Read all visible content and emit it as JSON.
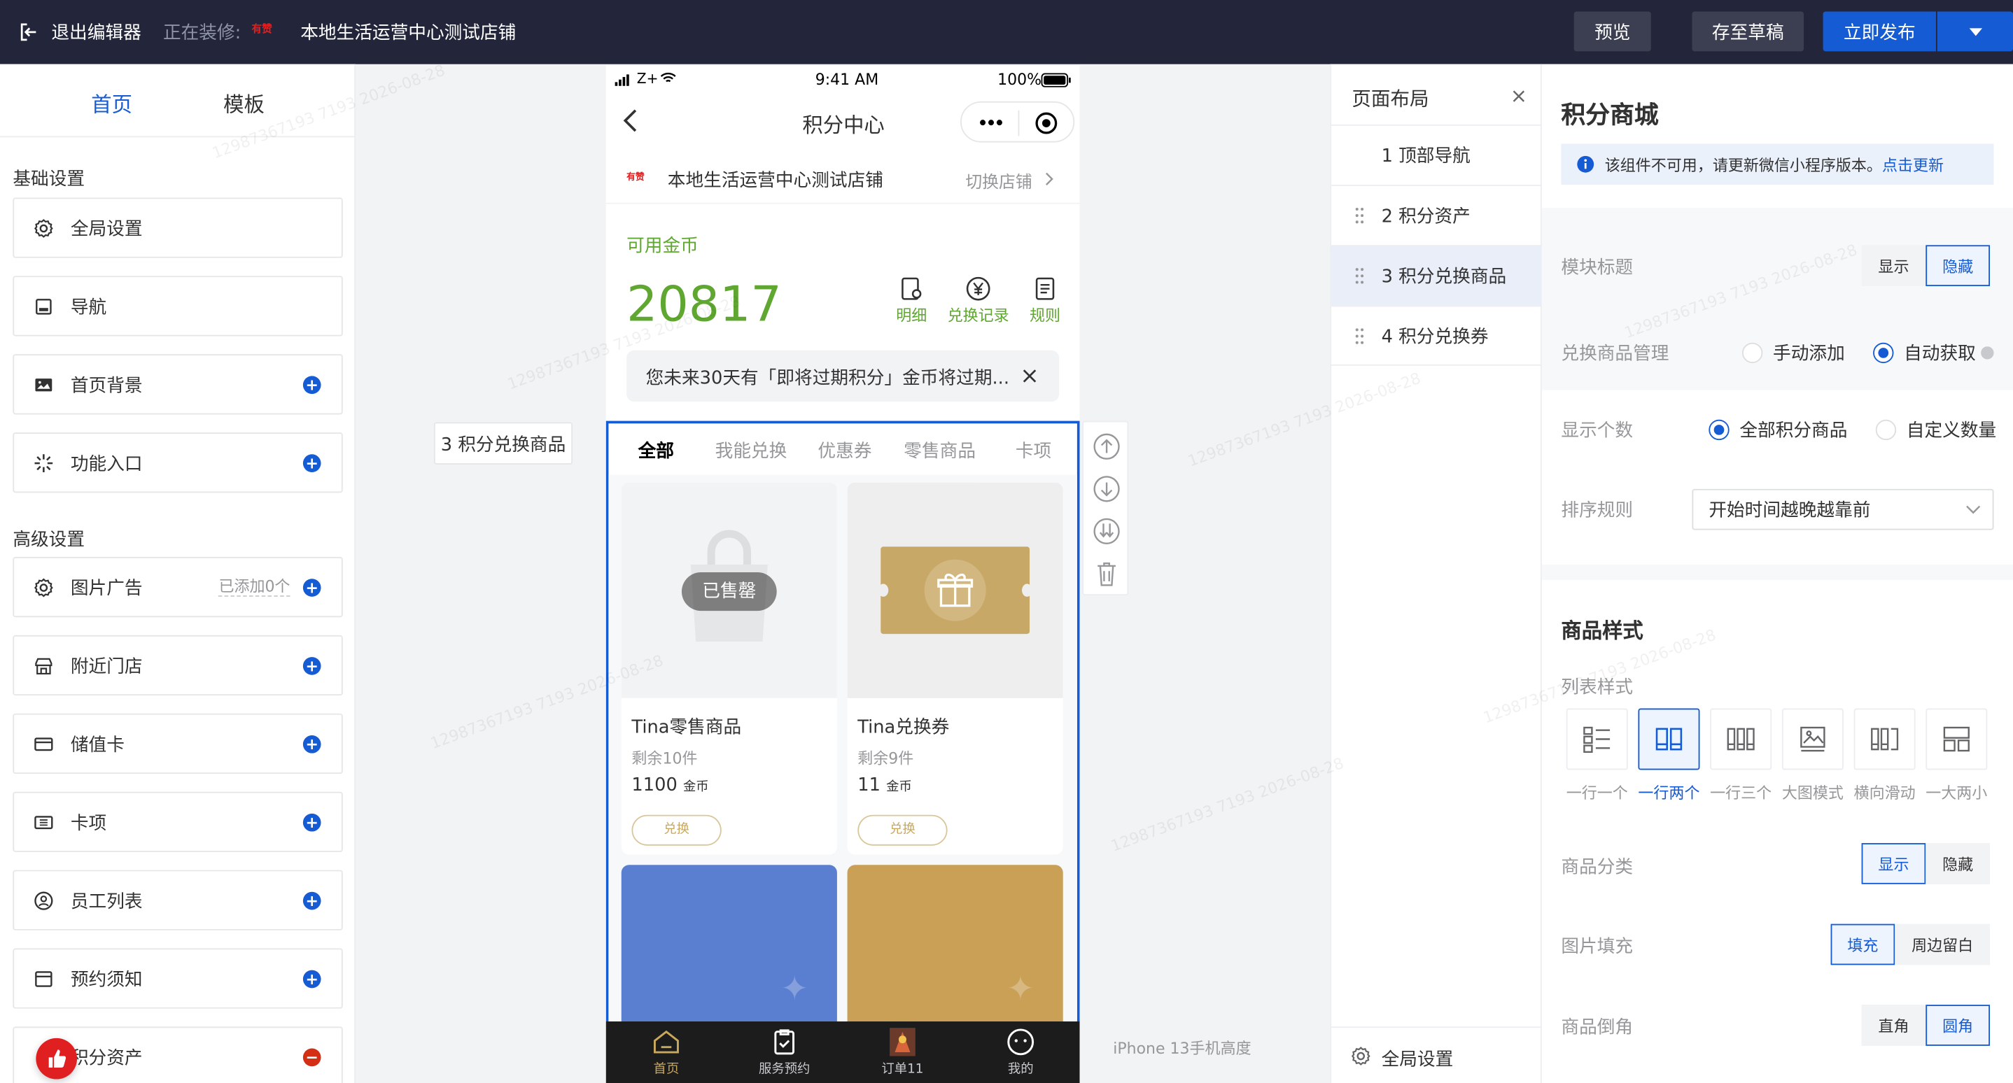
{
  "topbar": {
    "exit_label": "退出编辑器",
    "editing_label": "正在装修:",
    "shop_logo_text": "有赞",
    "shop_name": "本地生活运营中心测试店铺",
    "preview": "预览",
    "save_draft": "存至草稿",
    "publish": "立即发布"
  },
  "left": {
    "tabs": [
      "首页",
      "模板"
    ],
    "basic_title": "基础设置",
    "advanced_title": "高级设置",
    "items": [
      {
        "label": "全局设置",
        "icon": "gear-icon"
      },
      {
        "label": "导航",
        "icon": "nav-icon"
      },
      {
        "label": "首页背景",
        "icon": "image-icon"
      },
      {
        "label": "功能入口",
        "icon": "spark-icon"
      },
      {
        "label": "图片广告",
        "icon": "gear-icon",
        "note": "已添加0个"
      },
      {
        "label": "附近门店",
        "icon": "store-icon"
      },
      {
        "label": "储值卡",
        "icon": "card-icon"
      },
      {
        "label": "卡项",
        "icon": "ticket-icon"
      },
      {
        "label": "员工列表",
        "icon": "user-icon"
      },
      {
        "label": "预约须知",
        "icon": "notice-icon"
      },
      {
        "label": "积分资产",
        "icon": "bulb-icon"
      }
    ]
  },
  "canvas": {
    "component_label": "3 积分兑换商品",
    "iphone_height": "iPhone 13手机高度"
  },
  "phone": {
    "status": {
      "carrier": "Z+",
      "time": "9:41 AM",
      "battery": "100%"
    },
    "title": "积分中心",
    "shop_name": "本地生活运营中心测试店铺",
    "switch_shop": "切换店铺",
    "coin_label": "可用金币",
    "coin_value": "20817",
    "quick": [
      "明细",
      "兑换记录",
      "规则"
    ],
    "notice": "您未来30天有「即将过期积分」金币将过期...",
    "tabs": [
      "全部",
      "我能兑换",
      "优惠券",
      "零售商品",
      "卡项"
    ],
    "products": [
      {
        "name": "Tina零售商品",
        "stock": "剩余10件",
        "price": "1100",
        "unit": "金币",
        "btn": "兑换",
        "sold_out": "已售罄"
      },
      {
        "name": "Tina兑换券",
        "stock": "剩余9件",
        "price": "11",
        "unit": "金币",
        "btn": "兑换"
      }
    ],
    "bottom_nav": [
      "首页",
      "服务预约",
      "订单11",
      "我的"
    ]
  },
  "layout": {
    "title": "页面布局",
    "items": [
      "1 顶部导航",
      "2 积分资产",
      "3 积分兑换商品",
      "4 积分兑换券"
    ],
    "global": "全局设置"
  },
  "right": {
    "title": "积分商城",
    "alert": "该组件不可用，请更新微信小程序版本。",
    "alert_link": "点击更新",
    "module_title": "模块标题",
    "show": "显示",
    "hide": "隐藏",
    "manage": "兑换商品管理",
    "manual": "手动添加",
    "auto": "自动获取",
    "count": "显示个数",
    "all_goods": "全部积分商品",
    "custom_count": "自定义数量",
    "sort": "排序规则",
    "sort_value": "开始时间越晚越靠前",
    "style_title": "商品样式",
    "list_style": "列表样式",
    "list_options": [
      "一行一个",
      "一行两个",
      "一行三个",
      "大图模式",
      "横向滑动",
      "一大两小"
    ],
    "category": "商品分类",
    "fill": "图片填充",
    "fill_on": "填充",
    "fill_off": "周边留白",
    "corner": "商品倒角",
    "square": "直角",
    "round": "圆角"
  },
  "watermark": "12987367193 7193 2026-08-28",
  "colors": {
    "accent": "#155bd4",
    "coin": "#5fa731",
    "topbar": "#23263a",
    "danger": "#d42f15"
  }
}
